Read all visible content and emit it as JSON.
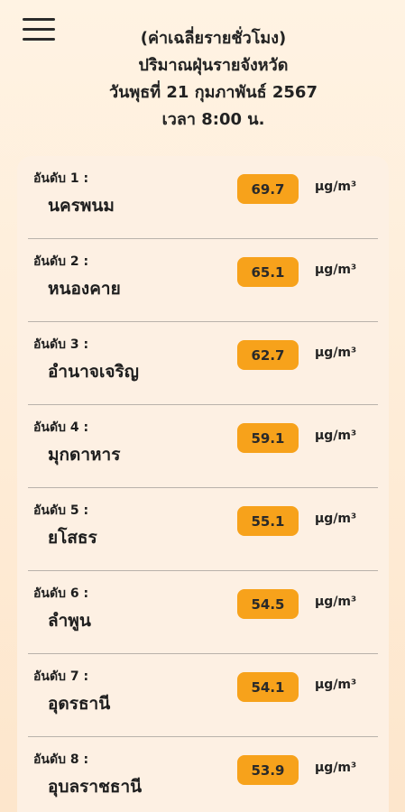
{
  "header": {
    "line1": "(ค่าเฉลี่ยรายชั่วโมง)",
    "line2": "ปริมาณฝุ่นรายจังหวัด",
    "line3": "วันพุธที่ 21 กุมภาพันธ์ 2567",
    "line4": "เวลา 8:00 น."
  },
  "unit": "µg/m³",
  "colors": {
    "badge": "#f7a21b",
    "background": "#fff3e3",
    "card": "#fdf0e3"
  },
  "rankings": [
    {
      "rank": "อันดับ 1 :",
      "province": "นครพนม",
      "value": "69.7"
    },
    {
      "rank": "อันดับ 2 :",
      "province": "หนองคาย",
      "value": "65.1"
    },
    {
      "rank": "อันดับ 3 :",
      "province": "อำนาจเจริญ",
      "value": "62.7"
    },
    {
      "rank": "อันดับ 4 :",
      "province": "มุกดาหาร",
      "value": "59.1"
    },
    {
      "rank": "อันดับ 5 :",
      "province": "ยโสธร",
      "value": "55.1"
    },
    {
      "rank": "อันดับ 6 :",
      "province": "ลำพูน",
      "value": "54.5"
    },
    {
      "rank": "อันดับ 7 :",
      "province": "อุดรธานี",
      "value": "54.1"
    },
    {
      "rank": "อันดับ 8 :",
      "province": "อุบลราชธานี",
      "value": "53.9"
    }
  ]
}
